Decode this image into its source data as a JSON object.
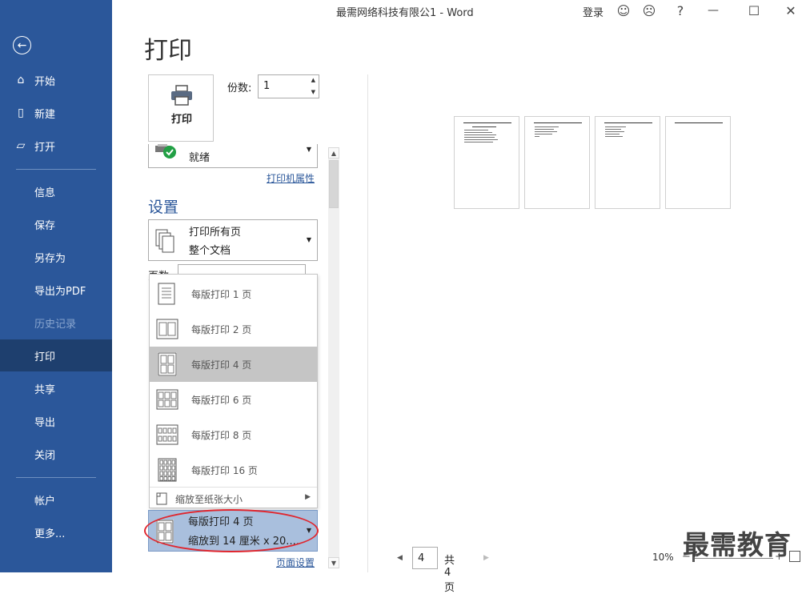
{
  "window": {
    "title": "最需网络科技有限公1  -  Word",
    "login": "登录",
    "help": "?"
  },
  "nav": {
    "back_icon": "back-arrow-icon",
    "items": [
      {
        "label": "开始",
        "icon": "home-icon"
      },
      {
        "label": "新建",
        "icon": "new-doc-icon"
      },
      {
        "label": "打开",
        "icon": "folder-open-icon"
      },
      {
        "label": "信息"
      },
      {
        "label": "保存"
      },
      {
        "label": "另存为"
      },
      {
        "label": "导出为PDF"
      },
      {
        "label": "历史记录",
        "disabled": true
      },
      {
        "label": "打印",
        "active": true
      },
      {
        "label": "共享"
      },
      {
        "label": "导出"
      },
      {
        "label": "关闭"
      },
      {
        "label": "帐户"
      },
      {
        "label": "更多..."
      }
    ]
  },
  "print": {
    "page_title": "打印",
    "print_button_label": "打印",
    "copies_label": "份数:",
    "copies_value": "1",
    "printer_status": "就绪",
    "printer_properties": "打印机属性",
    "settings_heading": "设置",
    "pages_option_line1": "打印所有页",
    "pages_option_line2": "整个文档",
    "pages_label": "页数:",
    "page_setup": "页面设置"
  },
  "popup": {
    "options": [
      {
        "label": "每版打印 1 页"
      },
      {
        "label": "每版打印 2 页"
      },
      {
        "label": "每版打印 4 页",
        "selected": true
      },
      {
        "label": "每版打印 6 页"
      },
      {
        "label": "每版打印 8 页"
      },
      {
        "label": "每版打印 16 页"
      }
    ],
    "scale_label": "缩放至纸张大小"
  },
  "pps": {
    "line1": "每版打印 4 页",
    "line2": "缩放到 14 厘米 x 20...."
  },
  "preview": {
    "current_page": "4",
    "total": "共 4 页",
    "zoom": "10%"
  },
  "watermark": "最需教育",
  "colors": {
    "nav_bg": "#2b579a",
    "nav_active": "#1e3f6e",
    "accent": "#2b579a",
    "highlight": "#e0262e"
  }
}
